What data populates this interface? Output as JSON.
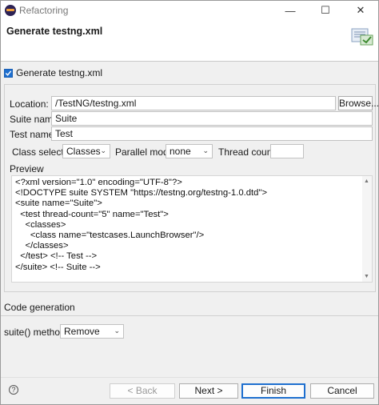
{
  "window": {
    "title": "Refactoring",
    "controls": {
      "minimize": "—",
      "maximize": "☐",
      "close": "✕"
    }
  },
  "header": {
    "title": "Generate testng.xml"
  },
  "generate_checkbox": {
    "label": "Generate testng.xml",
    "checked": true
  },
  "form": {
    "location_label": "Location:",
    "location_value": "/TestNG/testng.xml",
    "browse_label": "Browse...",
    "suite_name_label": "Suite name:",
    "suite_name_value": "Suite",
    "test_name_label": "Test name:",
    "test_name_value": "Test",
    "class_selection_label": "Class selection:",
    "class_selection_value": "Classes",
    "parallel_mode_label": "Parallel mode:",
    "parallel_mode_value": "none",
    "thread_count_label": "Thread count:",
    "thread_count_value": ""
  },
  "preview": {
    "label": "Preview",
    "text": "<?xml version=\"1.0\" encoding=\"UTF-8\"?>\n<!DOCTYPE suite SYSTEM \"https://testng.org/testng-1.0.dtd\">\n<suite name=\"Suite\">\n  <test thread-count=\"5\" name=\"Test\">\n    <classes>\n      <class name=\"testcases.LaunchBrowser\"/>\n    </classes>\n  </test> <!-- Test -->\n</suite> <!-- Suite -->"
  },
  "code_generation": {
    "label": "Code generation",
    "suite_methods_label": "suite() methods:",
    "suite_methods_value": "Remove"
  },
  "footer": {
    "help": "?",
    "back_label": "< Back",
    "next_label": "Next >",
    "finish_label": "Finish",
    "cancel_label": "Cancel"
  },
  "colors": {
    "accent": "#1e6fcf",
    "dialog_bg": "#f0f0f0"
  }
}
